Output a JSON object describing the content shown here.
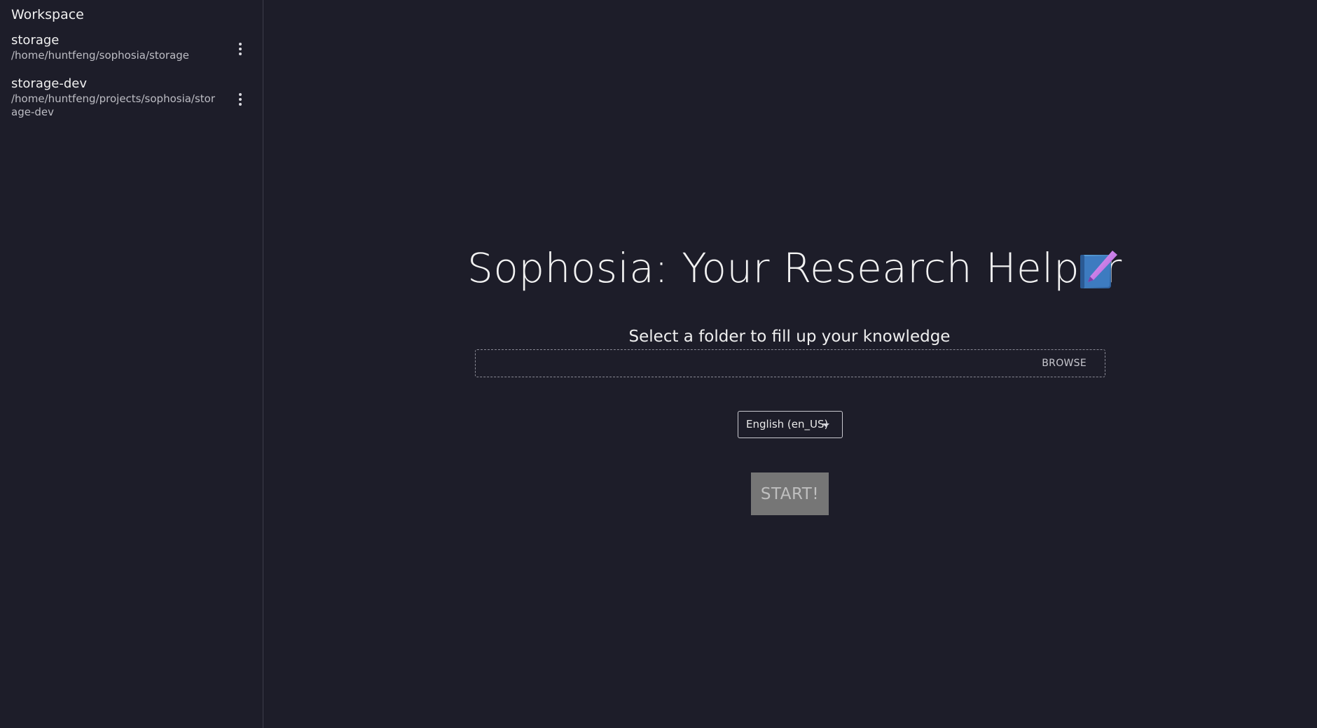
{
  "sidebar": {
    "title": "Workspace",
    "items": [
      {
        "name": "storage",
        "path": "/home/huntfeng/sophosia/storage",
        "menu_icon": "more-vertical-icon"
      },
      {
        "name": "storage-dev",
        "path": "/home/huntfeng/projects/sophosia/storage-dev",
        "menu_icon": "more-vertical-icon"
      }
    ]
  },
  "main": {
    "title": "Sophosia: Your Research Helper",
    "title_icon": "book-quill-icon",
    "subtitle": "Select a folder to fill up your knowledge",
    "folder_field": {
      "value": "",
      "browse_label": "BROWSE"
    },
    "language": {
      "selected": "English (en_US)"
    },
    "start_label": "START!"
  },
  "colors": {
    "background": "#1d1d29",
    "divider": "#3d3d4a",
    "start_button_bg": "#767676"
  }
}
